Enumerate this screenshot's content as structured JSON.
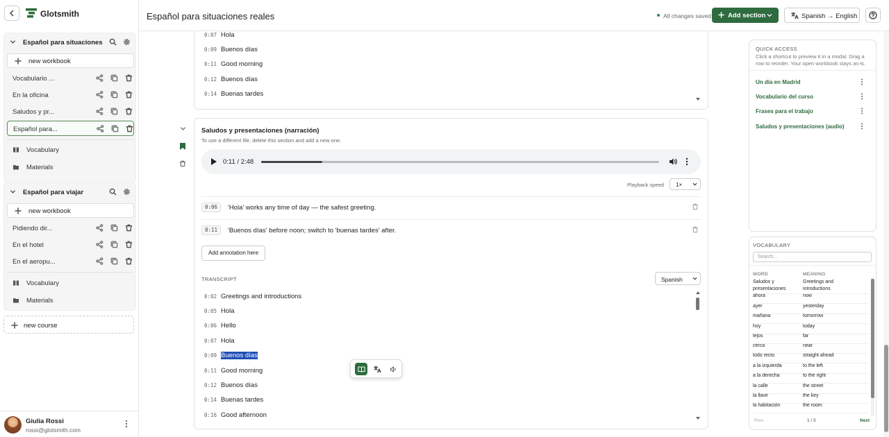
{
  "brand": "Glotsmith",
  "sidebar": {
    "courses": [
      {
        "title": "Español para situaciones ...",
        "new_workbook": "new workbook",
        "workbooks": [
          "Vocabulario ...",
          "En la oficina",
          "Saludos y pr...",
          "Español para..."
        ],
        "active_workbook": 3,
        "nav": [
          "Vocabulary",
          "Materials"
        ]
      },
      {
        "title": "Español para viajar",
        "new_workbook": "new workbook",
        "workbooks": [
          "Pidiendo dir...",
          "En el hotel",
          "En el aeropu..."
        ],
        "nav": [
          "Vocabulary",
          "Materials"
        ]
      }
    ],
    "new_course": "new course",
    "user": {
      "name": "Giulia Rossi",
      "email": "rossi@glotsmith.com"
    }
  },
  "header": {
    "title": "Español para situaciones reales",
    "saved": "All changes saved",
    "add_section": "Add section",
    "language": "Spanish → English"
  },
  "top_transcript": [
    {
      "t": "0:07",
      "text": "Hola"
    },
    {
      "t": "0:09",
      "text": "Buenos días"
    },
    {
      "t": "0:11",
      "text": "Good morning"
    },
    {
      "t": "0:12",
      "text": "Buenos días"
    },
    {
      "t": "0:14",
      "text": "Buenas tardes"
    }
  ],
  "section": {
    "title": "Saludos y presentaciones (narración)",
    "description": "To use a different file, delete this section and add a new one.",
    "player": {
      "time": "0:11 / 2:48",
      "progress": 0.153
    },
    "speed_label": "Playback speed",
    "speed": "1×",
    "annotations": [
      {
        "t": "0:06",
        "text": "'Hola' works any time of day — the safest greeting."
      },
      {
        "t": "0:11",
        "text": "'Buenos días' before noon; switch to 'buenas tardes' after."
      }
    ],
    "add_annotation": "Add annotation here",
    "transcript_label": "TRANSCRIPT",
    "transcript_lang": "Spanish",
    "transcript": [
      {
        "t": "0:02",
        "text": "Greetings and introductions"
      },
      {
        "t": "0:05",
        "text": "Hola"
      },
      {
        "t": "0:06",
        "text": "Hello"
      },
      {
        "t": "0:07",
        "text": "Hola"
      },
      {
        "t": "0:09",
        "text": "Buenos días"
      },
      {
        "t": "0:11",
        "text": "Good morning"
      },
      {
        "t": "0:12",
        "text": "Buenos días"
      },
      {
        "t": "0:14",
        "text": "Buenas tardes"
      },
      {
        "t": "0:16",
        "text": "Good afternoon"
      }
    ]
  },
  "quick_access": {
    "title": "QUICK ACCESS",
    "description": "Click a shortcut to preview it in a modal. Drag a row to reorder. Your open workbook stays as-is.",
    "items": [
      "Un día en Madrid",
      "Vocabulario del curso",
      "Frases para el trabajo",
      "Saludos y presentaciones (audio)"
    ]
  },
  "vocabulary": {
    "title": "VOCABULARY",
    "search_placeholder": "Search...",
    "headers": [
      "WORD",
      "MEANING"
    ],
    "rows": [
      [
        "Saludos y presentaciones",
        "Greetings and introductions"
      ],
      [
        "ahora",
        "now"
      ],
      [
        "ayer",
        "yesterday"
      ],
      [
        "mañana",
        "tomorrow"
      ],
      [
        "hoy",
        "today"
      ],
      [
        "lejos",
        "far"
      ],
      [
        "cerca",
        "near"
      ],
      [
        "todo recto",
        "straight ahead"
      ],
      [
        "a la izquierda",
        "to the left"
      ],
      [
        "a la derecha",
        "to the right"
      ],
      [
        "la calle",
        "the street"
      ],
      [
        "la llave",
        "the key"
      ],
      [
        "la habitación",
        "the room"
      ]
    ],
    "prev": "Prev",
    "page": "1 / 5",
    "next": "Next"
  },
  "colors": {
    "accent": "#2e6b3e",
    "highlight": "#1f4fb5",
    "link": "#2e6b3e"
  }
}
